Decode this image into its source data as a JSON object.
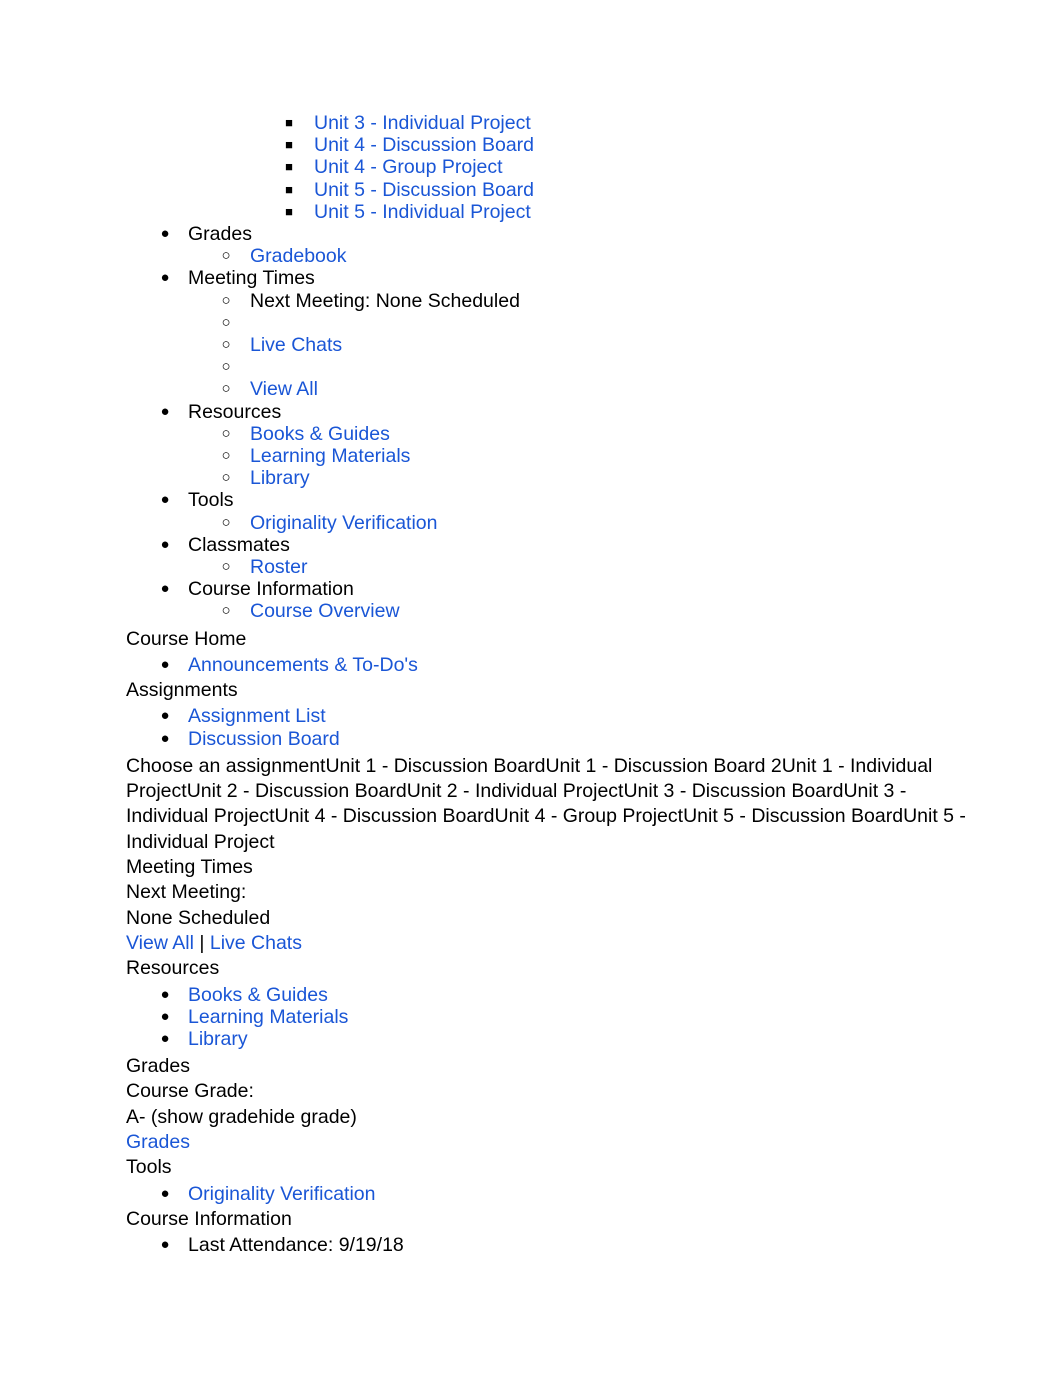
{
  "markers": {
    "disc": "●",
    "circle": "○",
    "square": "■"
  },
  "colors": {
    "link": "#1a56d6",
    "text": "#000000",
    "background": "#ffffff"
  },
  "nav_tree": {
    "assignment_sublinks": [
      "Unit 3 - Individual Project",
      "Unit 4 - Discussion Board",
      "Unit 4 - Group Project",
      "Unit 5 - Discussion Board",
      "Unit 5 - Individual Project"
    ],
    "sections": [
      {
        "label": "Grades",
        "children": [
          {
            "label": "Gradebook",
            "link": true
          }
        ]
      },
      {
        "label": "Meeting Times",
        "children": [
          {
            "label": "Next Meeting: None Scheduled",
            "link": false
          },
          {
            "label": "",
            "link": false
          },
          {
            "label": "Live Chats",
            "link": true
          },
          {
            "label": "",
            "link": false
          },
          {
            "label": "View All",
            "link": true
          }
        ]
      },
      {
        "label": "Resources",
        "children": [
          {
            "label": "Books & Guides",
            "link": true
          },
          {
            "label": "Learning Materials",
            "link": true
          },
          {
            "label": "Library",
            "link": true
          }
        ]
      },
      {
        "label": "Tools",
        "children": [
          {
            "label": "Originality Verification",
            "link": true
          }
        ]
      },
      {
        "label": "Classmates",
        "children": [
          {
            "label": "Roster",
            "link": true
          }
        ]
      },
      {
        "label": "Course Information",
        "children": [
          {
            "label": "Course Overview",
            "link": true
          }
        ]
      }
    ]
  },
  "flow": {
    "course_home_heading": "Course Home",
    "announcements_link": "Announcements & To-Do's",
    "assignments_heading": "Assignments",
    "assignment_list_link": "Assignment List",
    "discussion_board_link": "Discussion Board",
    "assignment_select_text": "Choose an assignmentUnit 1 - Discussion BoardUnit 1 - Discussion Board 2Unit 1 - Individual ProjectUnit 2 - Discussion BoardUnit 2 - Individual ProjectUnit 3 - Discussion BoardUnit 3 - Individual ProjectUnit 4 - Discussion BoardUnit 4 - Group ProjectUnit 5 - Discussion BoardUnit 5 - Individual Project",
    "meeting_times_heading": "Meeting Times",
    "next_meeting_label": "Next Meeting:",
    "next_meeting_value": "None Scheduled",
    "view_all_link": "View All",
    "link_separator": " | ",
    "live_chats_link": "Live Chats",
    "resources_heading": "Resources",
    "resources_links": [
      "Books & Guides",
      "Learning Materials",
      "Library"
    ],
    "grades_heading": "Grades",
    "course_grade_label": "Course Grade:",
    "course_grade_value": "A- (show gradehide grade)",
    "grades_link": "Grades",
    "tools_heading": "Tools",
    "originality_link": "Originality Verification",
    "course_information_heading": "Course Information",
    "last_attendance": "Last Attendance: 9/19/18"
  }
}
